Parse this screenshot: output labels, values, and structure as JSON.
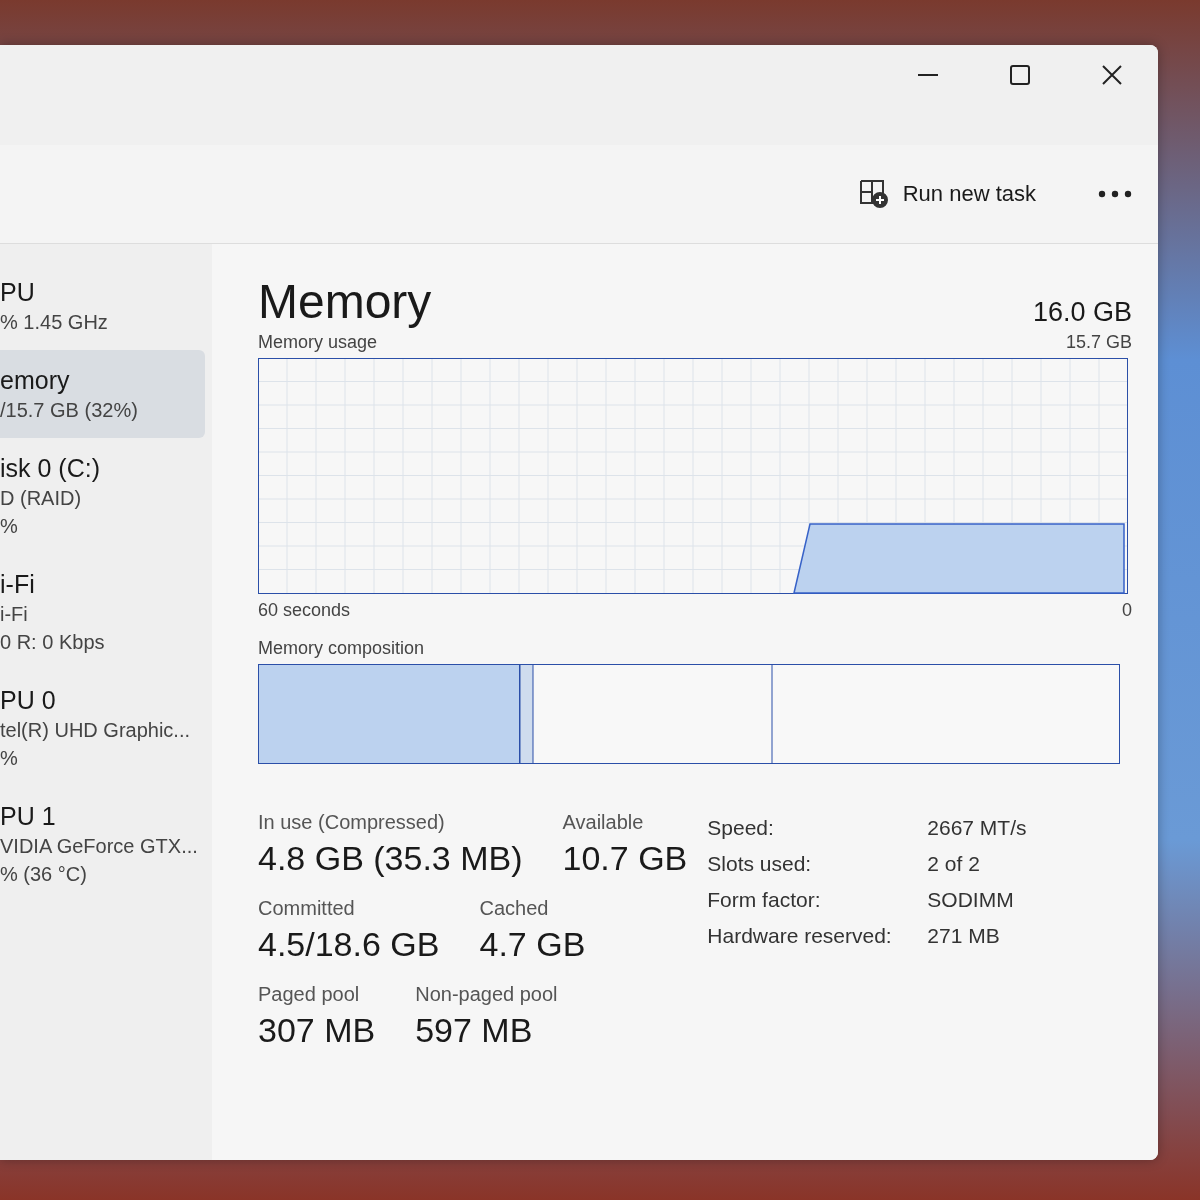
{
  "window": {
    "controls": [
      {
        "kind": "minimize"
      },
      {
        "kind": "maximize"
      },
      {
        "kind": "close"
      }
    ]
  },
  "toolbar": {
    "run_new_task": "Run new task"
  },
  "sidebar": {
    "items": [
      {
        "title": "PU",
        "lines": [
          "% 1.45 GHz"
        ],
        "selected": false
      },
      {
        "title": "emory",
        "lines": [
          "/15.7 GB (32%)"
        ],
        "selected": true
      },
      {
        "title": "isk 0 (C:)",
        "lines": [
          "D (RAID)",
          "%"
        ],
        "selected": false
      },
      {
        "title": "i-Fi",
        "lines": [
          "i-Fi",
          "0 R: 0 Kbps"
        ],
        "selected": false
      },
      {
        "title": "PU 0",
        "lines": [
          "tel(R) UHD Graphic...",
          "%"
        ],
        "selected": false
      },
      {
        "title": "PU 1",
        "lines": [
          "VIDIA GeForce GTX...",
          "% (36 °C)"
        ],
        "selected": false
      }
    ]
  },
  "main": {
    "title": "Memory",
    "total": "16.0 GB",
    "usage_label": "Memory usage",
    "usage_max": "15.7 GB",
    "time_label": "60 seconds",
    "time_end": "0",
    "composition_label": "Memory composition",
    "stat_rows": [
      [
        {
          "label": "In use (Compressed)",
          "value": "4.8 GB (35.3 MB)"
        },
        {
          "label": "Available",
          "value": "10.7 GB"
        }
      ],
      [
        {
          "label": "Committed",
          "value": "4.5/18.6 GB"
        },
        {
          "label": "Cached",
          "value": "4.7 GB"
        }
      ],
      [
        {
          "label": "Paged pool",
          "value": "307 MB"
        },
        {
          "label": "Non-paged pool",
          "value": "597 MB"
        }
      ]
    ],
    "details": [
      {
        "label": "Speed:",
        "value": "2667 MT/s"
      },
      {
        "label": "Slots used:",
        "value": "2 of 2"
      },
      {
        "label": "Form factor:",
        "value": "SODIMM"
      },
      {
        "label": "Hardware reserved:",
        "value": "271 MB"
      }
    ]
  }
}
